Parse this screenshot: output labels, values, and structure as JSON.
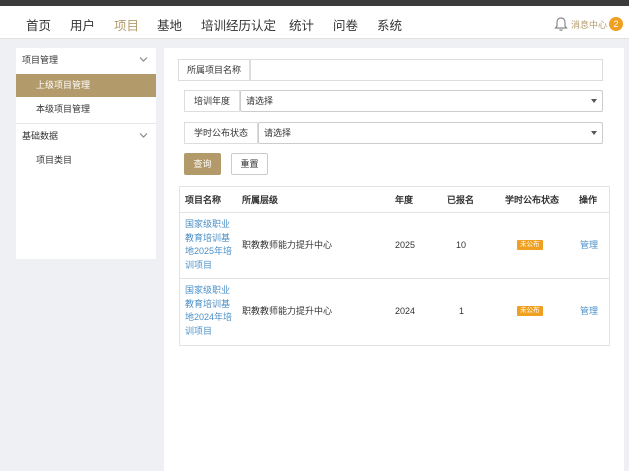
{
  "nav": {
    "items": [
      {
        "label": "首页",
        "active": false
      },
      {
        "label": "用户",
        "active": false
      },
      {
        "label": "项目",
        "active": true
      },
      {
        "label": "基地",
        "active": false
      },
      {
        "label": "培训经历认定",
        "active": false
      },
      {
        "label": "统计",
        "active": false
      },
      {
        "label": "问卷",
        "active": false
      },
      {
        "label": "系统",
        "active": false
      }
    ],
    "notify_label": "消息中心",
    "notify_count": "2"
  },
  "sidebar": {
    "groups": [
      {
        "label": "项目管理",
        "items": [
          {
            "label": "上级项目管理",
            "active": true
          },
          {
            "label": "本级项目管理",
            "active": false
          }
        ]
      },
      {
        "label": "基础数据",
        "items": [
          {
            "label": "项目类目",
            "active": false
          }
        ]
      }
    ]
  },
  "filters": {
    "project_name_label": "所属项目名称",
    "project_name_value": "",
    "year_label": "培训年度",
    "year_value": "请选择",
    "status_label": "学时公布状态",
    "status_value": "请选择",
    "query_button": "查询",
    "reset_button": "重置"
  },
  "table": {
    "headers": [
      "项目名称",
      "所属层级",
      "年度",
      "已报名",
      "学时公布状态",
      "操作"
    ],
    "rows": [
      {
        "name": "国家级职业教育培训基地2025年培训项目",
        "level": "职教教师能力提升中心",
        "year": "2025",
        "enrolled": "10",
        "status": "未公布",
        "action": "管理"
      },
      {
        "name": "国家级职业教育培训基地2024年培训项目",
        "level": "职教教师能力提升中心",
        "year": "2024",
        "enrolled": "1",
        "status": "未公布",
        "action": "管理"
      }
    ]
  },
  "colors": {
    "accent": "#b39a6b",
    "link": "#4a90c8",
    "badge": "#f0a020"
  }
}
